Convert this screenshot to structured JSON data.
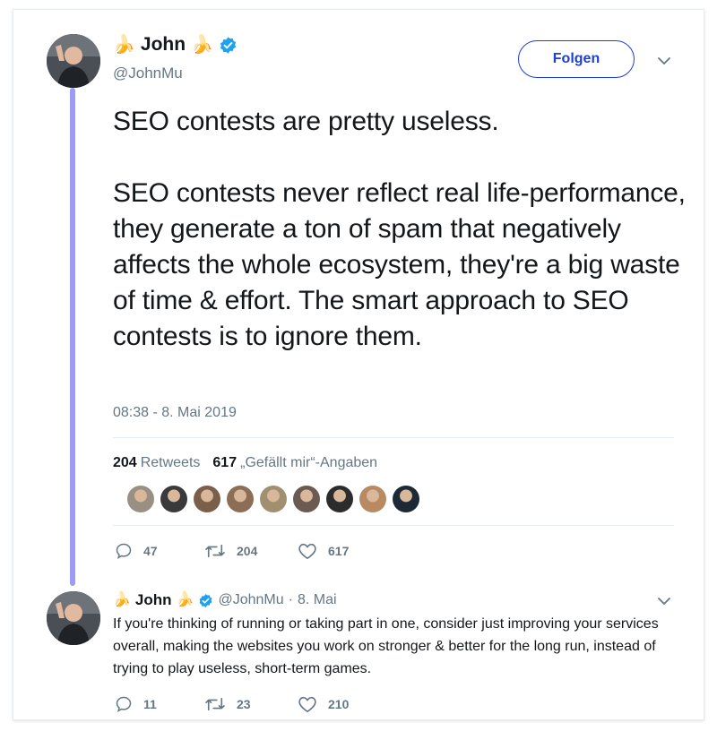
{
  "tweet": {
    "author": {
      "name": "John",
      "name_emoji": "🍌",
      "handle": "@JohnMu",
      "avatar_icon": "avatar-photo"
    },
    "follow_label": "Folgen",
    "text": "SEO contests are pretty useless.\n\nSEO contests never reflect real life-performance, they generate a ton of spam that negatively affects the whole ecosystem, they're a big waste of time & effort. The smart approach to SEO contests is to ignore them.",
    "timestamp": "08:38 - 8. Mai 2019",
    "retweet_count": "204",
    "retweet_label": "Retweets",
    "like_count": "617",
    "like_label": "„Gefällt mir“-Angaben",
    "actions": {
      "replies": "47",
      "retweets": "204",
      "likes": "617"
    },
    "liker_colors": [
      "#9a8f83",
      "#3a3a3a",
      "#7a5f4a",
      "#8b6e55",
      "#a09070",
      "#6a5a52",
      "#2c2c2c",
      "#b98a62",
      "#1d2a36"
    ]
  },
  "reply": {
    "name": "John",
    "name_emoji": "🍌",
    "handle": "@JohnMu",
    "separator": "·",
    "date": "8. Mai",
    "text": "If you're thinking of running or taking part in one, consider just improving your services overall, making the websites you work on stronger & better for the long run, instead of trying to play useless, short-term games.",
    "actions": {
      "replies": "11",
      "retweets": "23",
      "likes": "210"
    }
  },
  "colors": {
    "verified": "#1da1f2",
    "follow_accent": "#1d3fd6",
    "thread_line": "#9c9cf5",
    "muted_text": "#657786"
  }
}
